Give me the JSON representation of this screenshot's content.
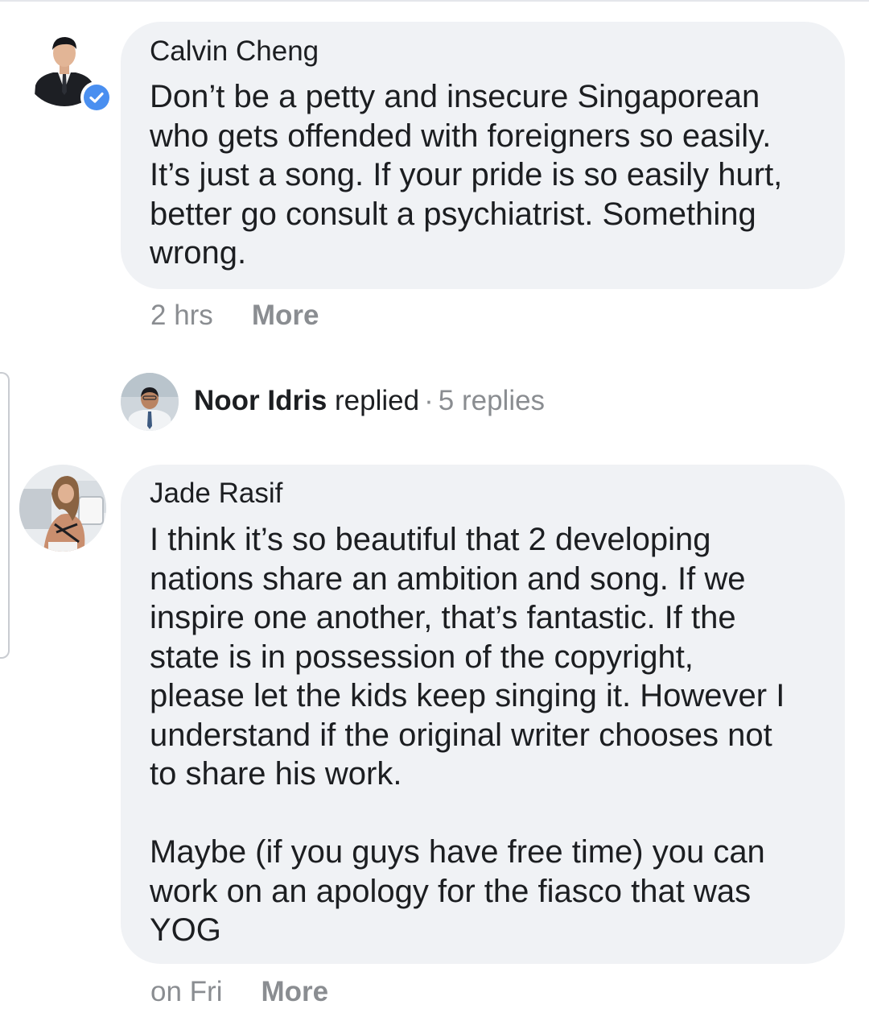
{
  "comments": [
    {
      "author": "Calvin Cheng",
      "verified": true,
      "text": "Don’t be a petty and insecure Singaporean\nwho gets offended with foreigners so easily.\nIt’s just a song. If your pride is so easily hurt,\nbetter go consult a psychiatrist. Something\nwrong.",
      "time": "2 hrs",
      "more_label": "More",
      "reply_summary": {
        "replier": "Noor Idris",
        "action": "replied",
        "separator": "·",
        "count_label": "5 replies"
      }
    },
    {
      "author": "Jade Rasif",
      "verified": false,
      "text": "I think it’s so beautiful that 2 developing\nnations share an ambition and song. If we\ninspire one another, that’s fantastic. If the\nstate is in possession of the copyright,\nplease let the kids keep singing it. However I\nunderstand if the original writer chooses not\nto share his work.\n\nMaybe (if you guys have free time) you can\nwork on an apology for the fiasco that was\nYOG",
      "time": "on Fri",
      "more_label": "More"
    }
  ],
  "icons": {
    "verified": "verified-check-icon"
  },
  "colors": {
    "bubble": "#f0f2f5",
    "meta_text": "#8a8d91",
    "verified_badge": "#4a8ff0"
  }
}
